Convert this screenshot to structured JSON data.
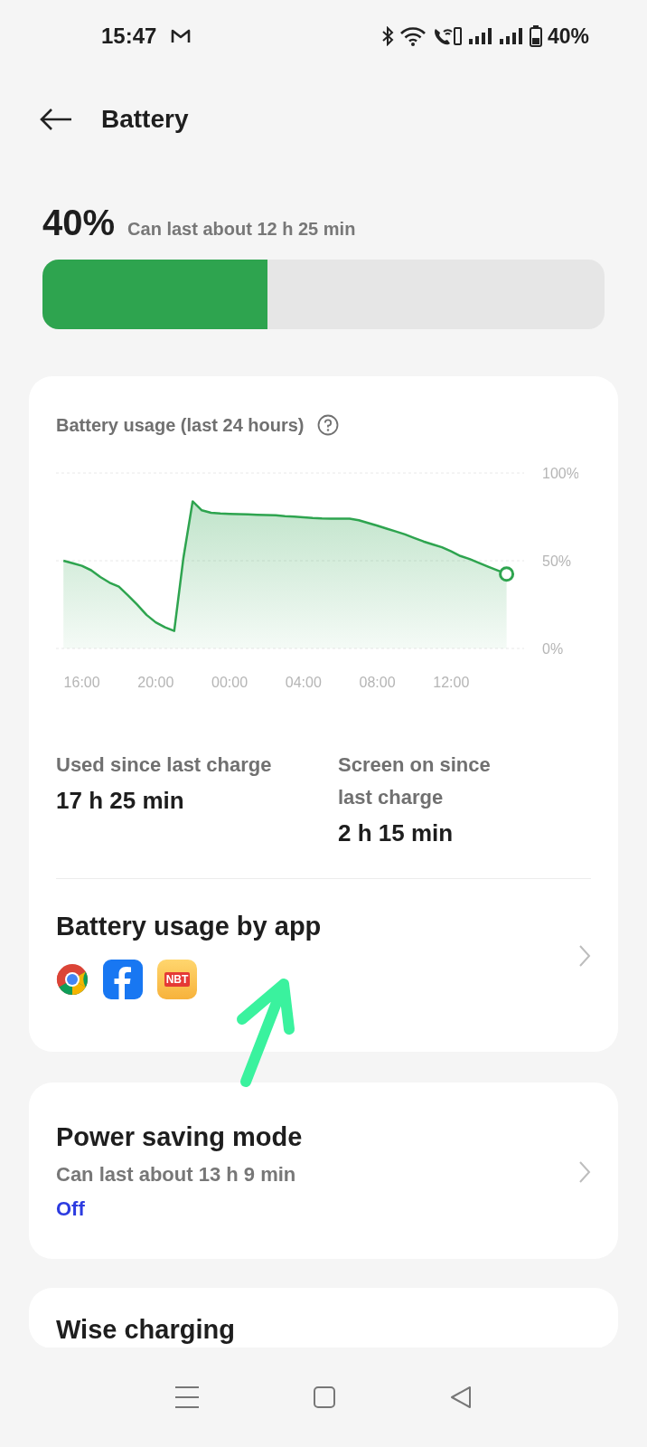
{
  "status_bar": {
    "time": "15:47",
    "battery_text": "40%"
  },
  "header": {
    "title": "Battery"
  },
  "summary": {
    "percent": "40%",
    "estimate": "Can last about 12 h 25 min",
    "level": 0.4
  },
  "usage_card": {
    "title": "Battery usage (last 24 hours)",
    "chart_data": {
      "type": "area",
      "categories": [
        null,
        null,
        "16:00",
        null,
        null,
        null,
        null,
        null,
        null,
        null,
        "20:00",
        null,
        null,
        null,
        null,
        null,
        null,
        null,
        "00:00",
        null,
        null,
        null,
        null,
        null,
        null,
        null,
        "04:00",
        null,
        null,
        null,
        null,
        null,
        null,
        null,
        "08:00",
        null,
        null,
        null,
        null,
        null,
        null,
        null,
        "12:00",
        null,
        null,
        null,
        null,
        null,
        null
      ],
      "series": [
        {
          "color": "#2ea44f",
          "values": [
            50,
            48.6,
            47.1,
            44.6,
            40.7,
            37.5,
            35.2,
            30.2,
            24.9,
            19.1,
            14.9,
            12,
            10,
            51.7,
            83.8,
            78.7,
            77.3,
            76.9,
            76.7,
            76.5,
            76.4,
            76.2,
            76.1,
            75.9,
            75.4,
            75.1,
            74.8,
            74.4,
            74.1,
            74,
            74,
            74,
            73.1,
            71.5,
            70,
            68.3,
            66.7,
            65,
            63,
            61,
            59.3,
            57.7,
            55.3,
            52.7,
            51,
            48.8,
            46.6,
            44.5,
            42.4
          ]
        }
      ],
      "ylim": [
        0,
        100
      ],
      "yticks": [
        {
          "value": 0,
          "label": "0%"
        },
        {
          "value": 50,
          "label": "50%"
        },
        {
          "value": 100,
          "label": "100%"
        }
      ]
    },
    "stats": [
      {
        "label": "Used since last charge",
        "value": "17 h 25 min"
      },
      {
        "label": "Screen on since last charge",
        "value": "2 h 15 min"
      }
    ],
    "apps_row": {
      "title": "Battery usage by app",
      "apps": [
        {
          "kind": "chrome"
        },
        {
          "kind": "facebook"
        },
        {
          "kind": "nbt",
          "label": "NBT"
        }
      ]
    }
  },
  "power_saving": {
    "title": "Power saving mode",
    "subtitle": "Can last about 13 h 9 min",
    "status": "Off"
  },
  "next_card": {
    "title": "Wise charging"
  }
}
